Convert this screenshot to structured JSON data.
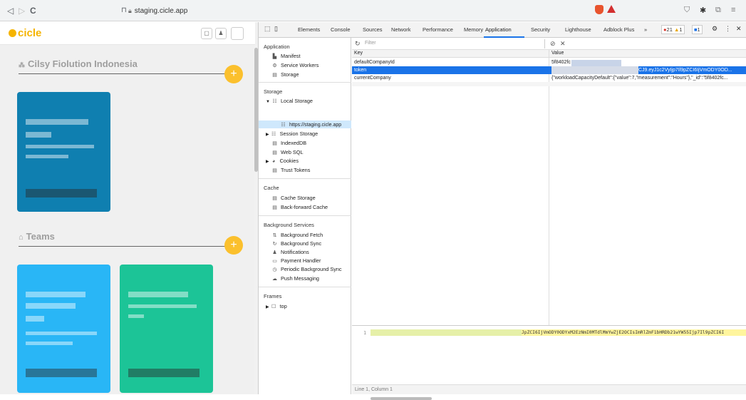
{
  "browser": {
    "nav_back": "◁",
    "nav_forward": "▷",
    "reload": "C",
    "bookmark": "⊓",
    "url": "staging.cicle.app",
    "shield_count": "",
    "menu": "≡"
  },
  "app": {
    "logo": "cicle",
    "company_title": "Cilsy Fiolution Indonesia",
    "teams_title": "Teams",
    "add_label": "+",
    "colors": {
      "yellow": "#fbc02d",
      "card1": "#0f7fb0",
      "card2": "#29b6f6",
      "card3": "#1cc497"
    }
  },
  "devtools": {
    "tabs": [
      "Elements",
      "Console",
      "Sources",
      "Network",
      "Performance",
      "Memory",
      "Application",
      "Security",
      "Lighthouse",
      "Adblock Plus",
      "»"
    ],
    "active_tab": "Application",
    "errors": "21",
    "warnings": "1",
    "issues": "1",
    "sidebar": {
      "application_header": "Application",
      "application_items": [
        "Manifest",
        "Service Workers",
        "Storage"
      ],
      "storage_header": "Storage",
      "local_storage": "Local Storage",
      "local_storage_child": "https://staging.cicle.app",
      "storage_items": [
        "Session Storage",
        "IndexedDB",
        "Web SQL",
        "Cookies",
        "Trust Tokens"
      ],
      "cache_header": "Cache",
      "cache_items": [
        "Cache Storage",
        "Back-forward Cache"
      ],
      "bg_header": "Background Services",
      "bg_items": [
        "Background Fetch",
        "Background Sync",
        "Notifications",
        "Payment Handler",
        "Periodic Background Sync",
        "Push Messaging"
      ],
      "frames_header": "Frames",
      "frames_items": [
        "top"
      ]
    },
    "filter_placeholder": "Filter",
    "columns": {
      "key": "Key",
      "value": "Value"
    },
    "rows": [
      {
        "key": "defaultCompanyId",
        "value": "5f8402fc"
      },
      {
        "key": "token",
        "value": "CJ9.eyJ1c2VyIjp7Il9pZCI6IjVmODY0OD..."
      },
      {
        "key": "currentCompany",
        "value": "{\"workloadCapacityDefault\":{\"value\":7,\"measurement\":\"Hours\"},\"_id\":\"5f8402fc..."
      }
    ],
    "preview_line_no": "1",
    "preview_text": "JpZCI6IjVmODY0ODYxM2EzNmI0MTdlMmYwZjE2OCIsImRlZmF1bHRDb21wYW55Ijp7Il9pZCI6I",
    "status": "Line 1, Column 1"
  }
}
